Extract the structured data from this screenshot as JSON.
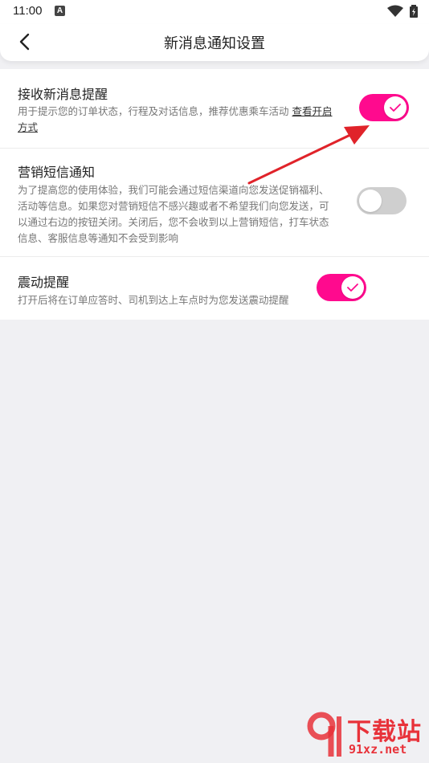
{
  "status_bar": {
    "time": "11:00",
    "notification_icon": "a-app-icon",
    "wifi_icon": "wifi-icon",
    "battery_icon": "battery-charging-icon"
  },
  "header": {
    "title": "新消息通知设置",
    "back_icon": "back-arrow-icon"
  },
  "settings": [
    {
      "title": "接收新消息提醒",
      "description": "用于提示您的订单状态，行程及对话信息，推荐优惠乘车活动 ",
      "link_text": "查看开启方式",
      "enabled": true
    },
    {
      "title": "营销短信通知",
      "description": "为了提高您的使用体验，我们可能会通过短信渠道向您发送促销福利、活动等信息。如果您对营销短信不感兴趣或者不希望我们向您发送，可以通过右边的按钮关闭。关闭后，您不会收到以上营销短信，打车状态信息、客服信息等通知不会受到影响",
      "enabled": false
    },
    {
      "title": "震动提醒",
      "description": "打开后将在订单应答时、司机到达上车点时为您发送震动提醒",
      "enabled": true
    }
  ],
  "watermark": {
    "title": "下载站",
    "url": "91xz.net"
  },
  "colors": {
    "accent": "#ff0a8e",
    "toggle_off": "#cfcfcf",
    "annotation_arrow": "#e0232a",
    "background": "#f0f0f3"
  }
}
